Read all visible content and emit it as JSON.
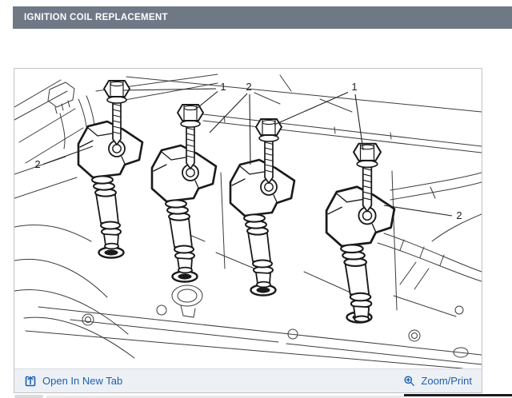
{
  "header": {
    "title": "IGNITION COIL REPLACEMENT"
  },
  "diagram": {
    "description": "Engine line drawing showing four ignition coils with mounting bolts",
    "callouts": [
      {
        "label": "1",
        "points_to": "coil mounting bolts 1 and 2"
      },
      {
        "label": "2",
        "points_to": "ignition coils 2 and 3"
      },
      {
        "label": "1",
        "points_to": "coil mounting bolts 3 and 4"
      },
      {
        "label": "2",
        "points_to": "ignition coil 1"
      },
      {
        "label": "2",
        "points_to": "ignition coil 4"
      }
    ]
  },
  "footer": {
    "open_in_new_tab": "Open In New Tab",
    "zoom_print": "Zoom/Print"
  },
  "colors": {
    "header_bg": "#6f7885",
    "link_blue": "#1d5fad",
    "footer_bg": "#edf1f5"
  }
}
